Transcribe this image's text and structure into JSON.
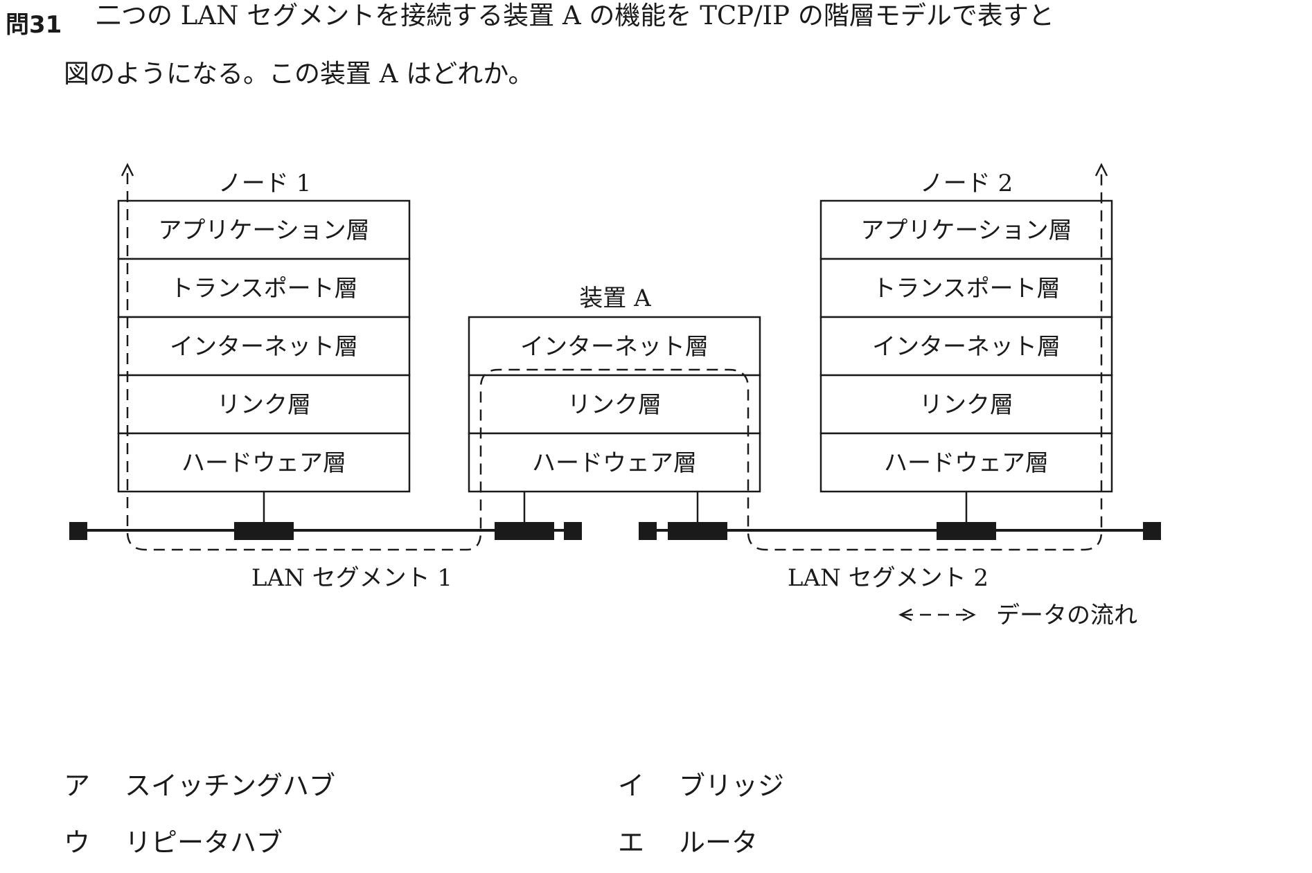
{
  "question": {
    "number": "問31",
    "line1": "二つの LAN セグメントを接続する装置 A の機能を TCP/IP の階層モデルで表すと",
    "line2": "図のようになる。この装置 A はどれか。"
  },
  "figure": {
    "node1": {
      "title": "ノード 1",
      "layers": [
        "アプリケーション層",
        "トランスポート層",
        "インターネット層",
        "リンク層",
        "ハードウェア層"
      ]
    },
    "device_a": {
      "title": "装置 A",
      "layers": [
        "インターネット層",
        "リンク層",
        "ハードウェア層"
      ]
    },
    "node2": {
      "title": "ノード 2",
      "layers": [
        "アプリケーション層",
        "トランスポート層",
        "インターネット層",
        "リンク層",
        "ハードウェア層"
      ]
    },
    "segments": [
      "LAN セグメント 1",
      "LAN セグメント 2"
    ],
    "legend": "データの流れ"
  },
  "choices": [
    {
      "label": "ア",
      "text": "スイッチングハブ"
    },
    {
      "label": "イ",
      "text": "ブリッジ"
    },
    {
      "label": "ウ",
      "text": "リピータハブ"
    },
    {
      "label": "エ",
      "text": "ルータ"
    }
  ]
}
